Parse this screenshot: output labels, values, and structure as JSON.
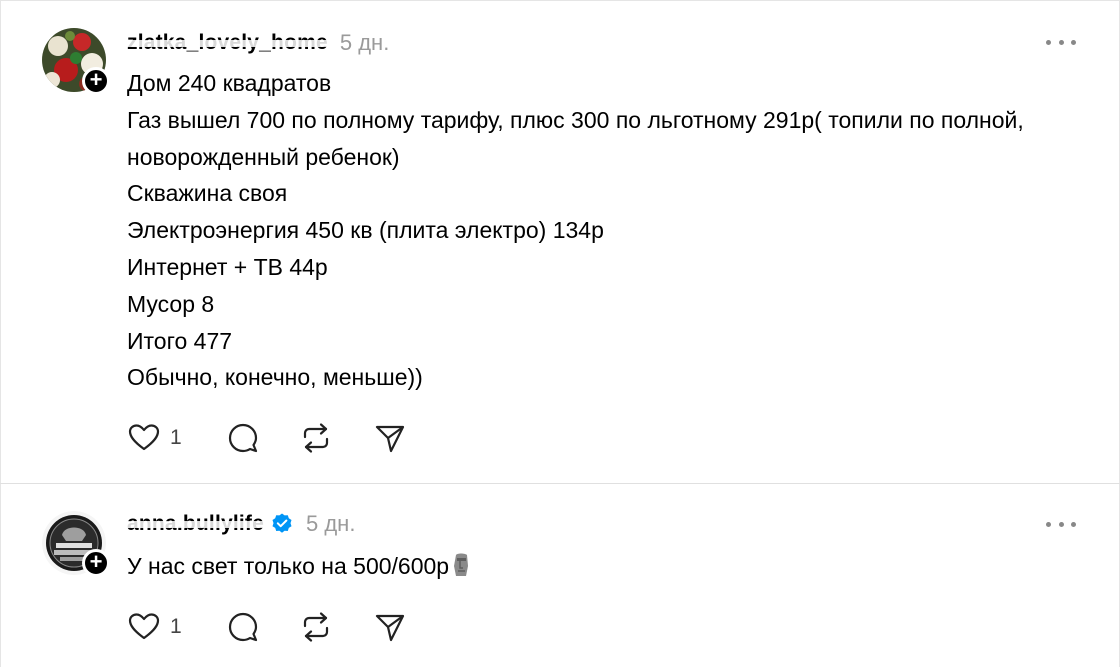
{
  "comments": [
    {
      "username": "zlatka_lovely_home",
      "time": "5 дн.",
      "verified": false,
      "lines": [
        "Дом 240 квадратов",
        "Газ вышел 700 по полному тарифу, плюс 300 по льготному 291р( топили по полной, новорожденный ребенок)",
        "Скважина своя",
        "Электроэнергия 450 кв (плита электро) 134р",
        "Интернет + ТВ 44р",
        "Мусор 8",
        "Итого 477",
        "Обычно, конечно, меньше))"
      ],
      "like_count": "1"
    },
    {
      "username": "anna.bullylife",
      "time": "5 дн.",
      "verified": true,
      "text": "У нас свет только на 500/600р",
      "emoji": "moai-icon",
      "like_count": "1"
    }
  ],
  "colors": {
    "text": "#000000",
    "muted": "#9a9a9a",
    "verified_blue": "#0095f6",
    "divider": "#e0e0e0"
  },
  "icons": [
    "heart-icon",
    "comment-icon",
    "repost-icon",
    "share-icon",
    "more-icon",
    "plus-icon",
    "verified-badge-icon"
  ]
}
